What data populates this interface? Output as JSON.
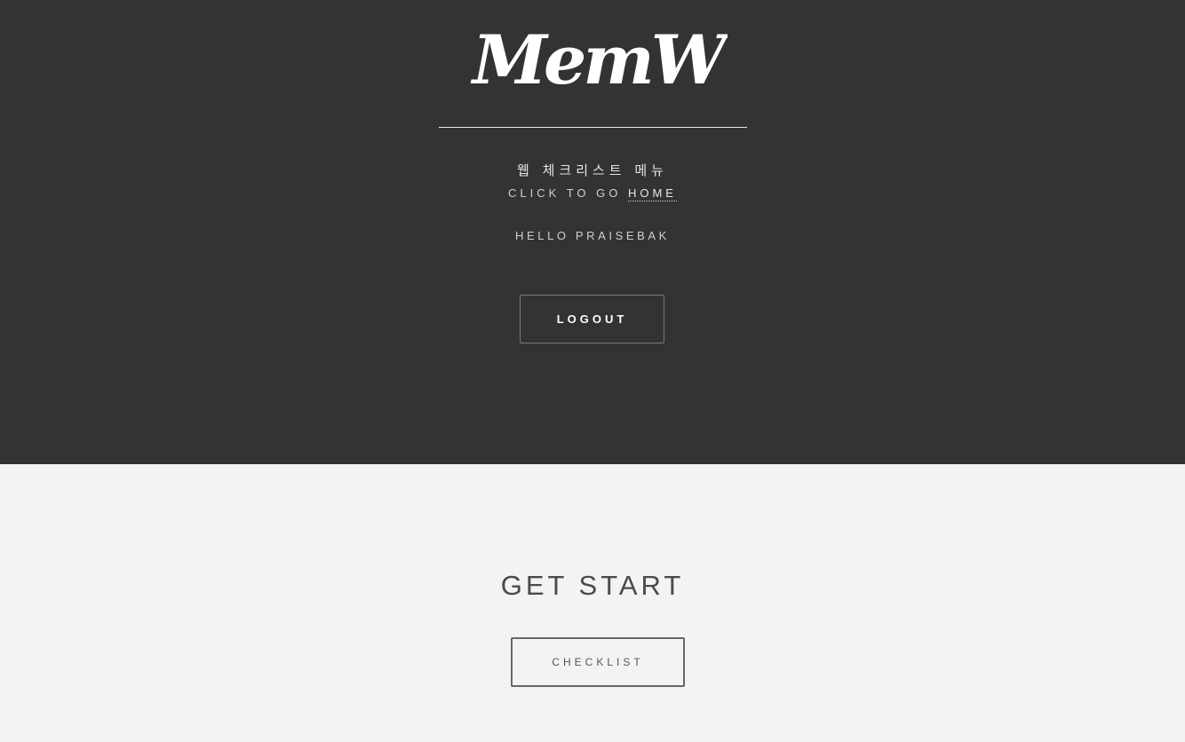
{
  "header": {
    "logo_text": "MemW",
    "subtitle": "웹 체크리스트 메뉴",
    "click_prefix": "CLICK TO GO ",
    "home_link": "HOME",
    "greeting": "HELLO PRAISEBAK",
    "logout_label": "LOGOUT"
  },
  "main": {
    "heading": "GET START",
    "checklist_label": "CHECKLIST"
  },
  "colors": {
    "hero_bg": "#333333",
    "lower_bg": "#f3f3f3",
    "logo": "#ffffff",
    "heading": "#4a4a4a"
  }
}
